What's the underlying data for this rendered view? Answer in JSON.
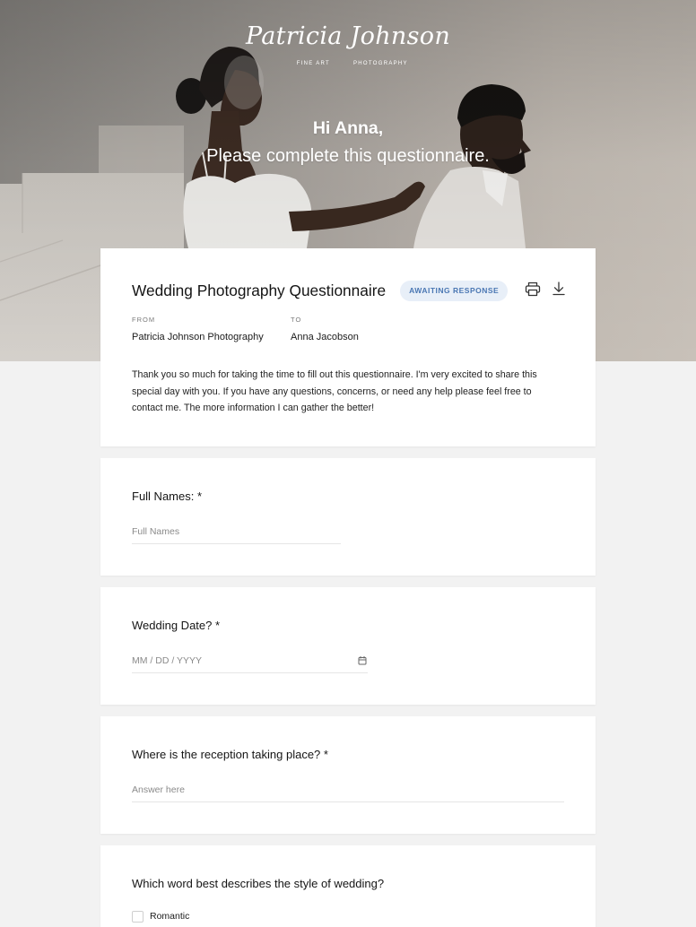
{
  "brand": {
    "logo_name": "Patricia Johnson",
    "logo_tagline_left": "FINE ART",
    "logo_tagline_right": "PHOTOGRAPHY"
  },
  "hero": {
    "greeting": "Hi Anna,",
    "subtitle": "Please complete this questionnaire."
  },
  "document": {
    "title": "Wedding Photography Questionnaire",
    "status": "AWAITING RESPONSE",
    "from_label": "FROM",
    "from_value": "Patricia Johnson Photography",
    "to_label": "TO",
    "to_value": "Anna Jacobson",
    "intro_lines": [
      "Thank you so much for taking the time to fill out this questionnaire. I'm very excited to share this",
      "special day with you. If you have any questions, concerns, or need any help please feel free to",
      "contact me. The more information I can gather the better!"
    ],
    "actions": [
      {
        "icon": "printer-icon"
      },
      {
        "icon": "download-icon"
      }
    ]
  },
  "questions": [
    {
      "label": "Full Names: *",
      "placeholder": "Full Names",
      "value": ""
    },
    {
      "label": "Wedding Date? *",
      "placeholder": "MM / DD / YYYY",
      "value": "",
      "icon": "calendar-icon"
    },
    {
      "label": "Where is the reception taking place? *",
      "placeholder": "Answer here",
      "value": ""
    },
    {
      "label": "Which word best describes the style of wedding?",
      "options": [
        {
          "label": "Romantic",
          "checked": false
        }
      ]
    }
  ],
  "colors": {
    "page_background": "#f2f2f2",
    "card_background": "#ffffff",
    "text": "#1a1a1a",
    "muted_text": "#8a8a8a",
    "badge_background": "#e8eff8",
    "badge_text": "#4a77b3",
    "divider": "#e6e6e6"
  }
}
